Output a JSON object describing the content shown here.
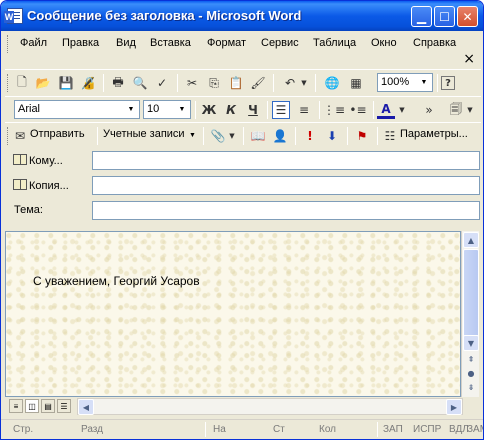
{
  "window": {
    "title": "Сообщение без заголовка - Microsoft Word"
  },
  "menu": {
    "items": [
      "Файл",
      "Правка",
      "Вид",
      "Вставка",
      "Формат",
      "Сервис",
      "Таблица",
      "Окно",
      "Справка"
    ],
    "close_symbol": "×"
  },
  "standard_toolbar": {
    "zoom": "100%",
    "help_symbol": "?"
  },
  "format_toolbar": {
    "font": "Arial",
    "size": "10",
    "bold": "Ж",
    "italic": "К",
    "underline": "Ч",
    "font_color_glyph": "A"
  },
  "email_toolbar": {
    "send_label": "Отправить",
    "accounts_label": "Учетные записи",
    "options_label": "Параметры..."
  },
  "fields": {
    "to_label": "Кому...",
    "cc_label": "Копия...",
    "subject_label": "Тема:",
    "to_value": "",
    "cc_value": "",
    "subject_value": ""
  },
  "document": {
    "body_text": "С уважением, Георгий Усаров"
  },
  "statusbar": {
    "page": "Стр.",
    "section": "Разд",
    "at": "На",
    "line": "Ст",
    "col": "Кол",
    "rec": "ЗАП",
    "trk": "ИСПР",
    "ext": "ВДЛ",
    "ovr": "ЗАМ"
  }
}
